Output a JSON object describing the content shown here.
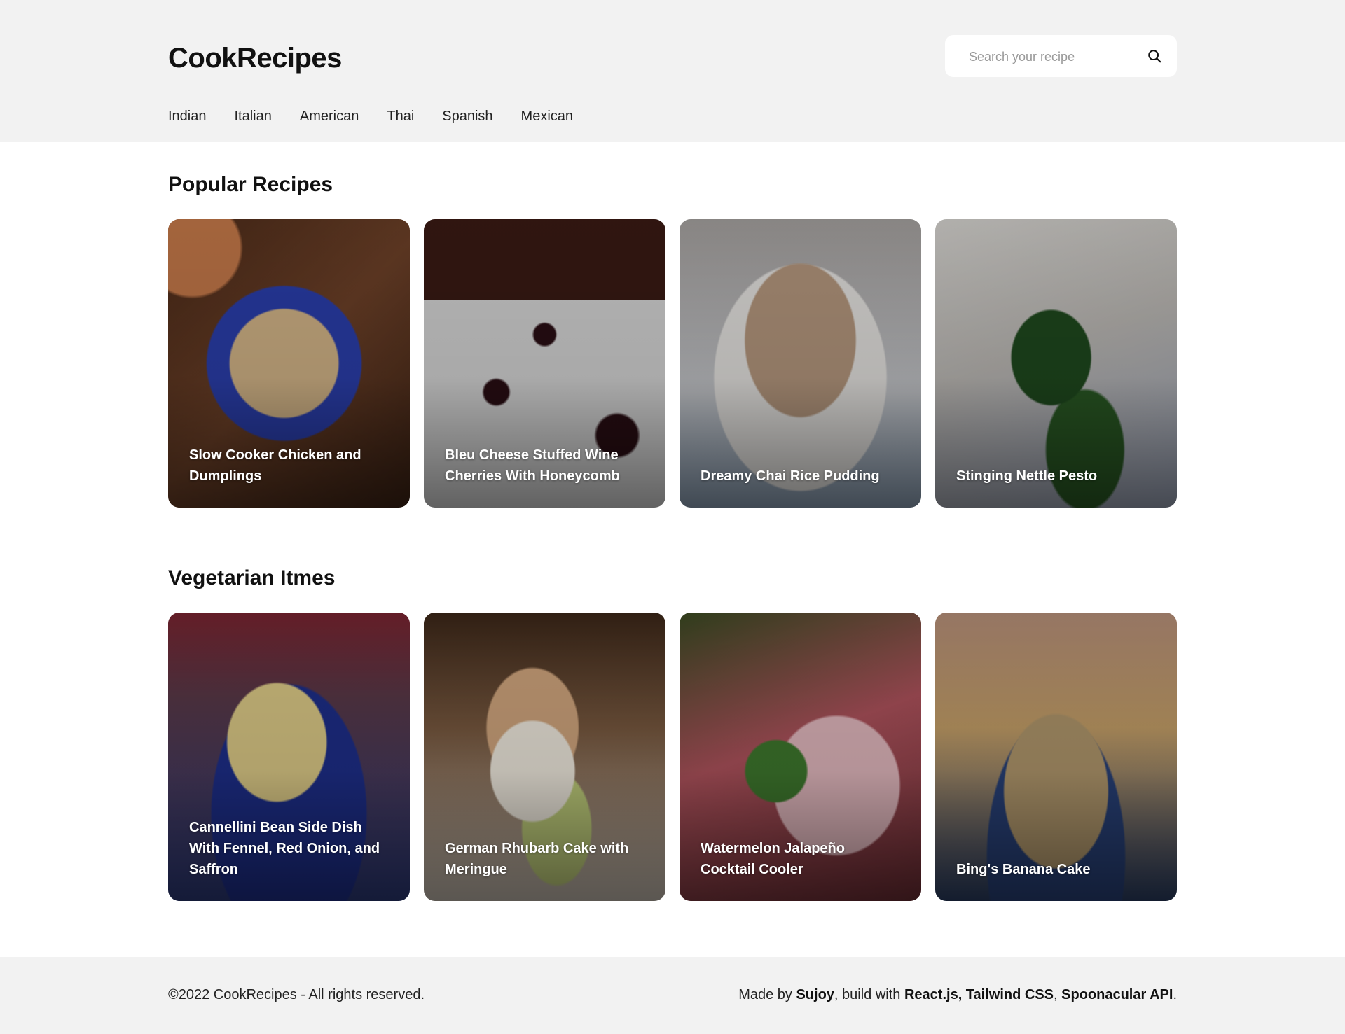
{
  "header": {
    "brand": "CookRecipes",
    "search_placeholder": "Search your recipe",
    "nav": [
      "Indian",
      "Italian",
      "American",
      "Thai",
      "Spanish",
      "Mexican"
    ]
  },
  "sections": [
    {
      "title": "Popular Recipes",
      "cards": [
        {
          "title": "Slow Cooker Chicken and Dumplings"
        },
        {
          "title": "Bleu Cheese Stuffed Wine Cherries With Honeycomb"
        },
        {
          "title": "Dreamy Chai Rice Pudding"
        },
        {
          "title": "Stinging Nettle Pesto"
        }
      ]
    },
    {
      "title": "Vegetarian Itmes",
      "cards": [
        {
          "title": "Cannellini Bean Side Dish With Fennel, Red Onion, and Saffron"
        },
        {
          "title": "German Rhubarb Cake with Meringue"
        },
        {
          "title": "Watermelon Jalapeño Cocktail Cooler"
        },
        {
          "title": "Bing's Banana Cake"
        }
      ]
    }
  ],
  "footer": {
    "copyright": "©2022 CookRecipes - All rights reserved.",
    "made_by_prefix": "Made by ",
    "author": "Sujoy",
    "build_with": ", build with ",
    "tech1": "React.js, Tailwind CSS",
    "sep": ", ",
    "tech2": "Spoonacular API",
    "end": "."
  }
}
